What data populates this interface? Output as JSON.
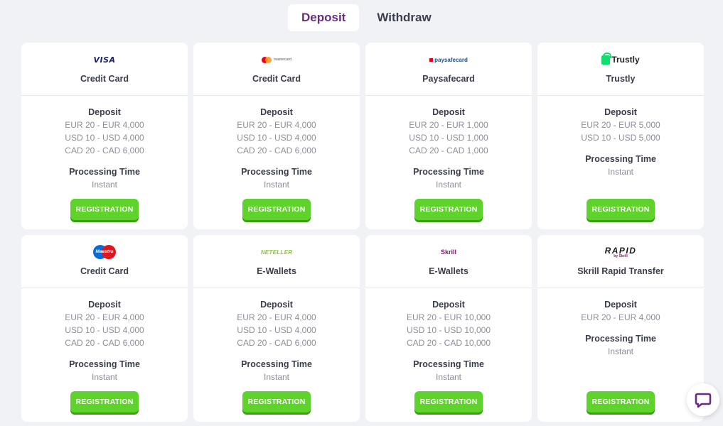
{
  "tabs": [
    {
      "label": "Deposit",
      "active": true
    },
    {
      "label": "Withdraw",
      "active": false
    }
  ],
  "labels": {
    "deposit": "Deposit",
    "processing_time": "Processing Time",
    "button": "REGISTRATION"
  },
  "methods": [
    {
      "logo": "visa-logo",
      "logo_text": "VISA",
      "name": "Credit Card",
      "limits": [
        "EUR 20 - EUR 4,000",
        "USD 10 - USD 4,000",
        "CAD 20 - CAD 6,000"
      ],
      "time": "Instant"
    },
    {
      "logo": "mastercard-logo",
      "logo_text": "mastercard",
      "name": "Credit Card",
      "limits": [
        "EUR 20 - EUR 4,000",
        "USD 10 - USD 4,000",
        "CAD 20 - CAD 6,000"
      ],
      "time": "Instant"
    },
    {
      "logo": "paysafecard-logo",
      "logo_text": "paysafecard",
      "name": "Paysafecard",
      "limits": [
        "EUR 20 - EUR 1,000",
        "USD 10 - USD 1,000",
        "CAD 20 - CAD 1,000"
      ],
      "time": "Instant"
    },
    {
      "logo": "trustly-logo",
      "logo_text": "Trustly",
      "name": "Trustly",
      "limits": [
        "EUR 20 - EUR 5,000",
        "USD 10 - USD 5,000"
      ],
      "time": "Instant"
    },
    {
      "logo": "maestro-logo",
      "logo_text": "Maestro",
      "name": "Credit Card",
      "limits": [
        "EUR 20 - EUR 4,000",
        "USD 10 - USD 4,000",
        "CAD 20 - CAD 6,000"
      ],
      "time": "Instant"
    },
    {
      "logo": "neteller-logo",
      "logo_text": "NETELLER",
      "name": "E-Wallets",
      "limits": [
        "EUR 20 - EUR 4,000",
        "USD 10 - USD 4,000",
        "CAD 20 - CAD 6,000"
      ],
      "time": "Instant"
    },
    {
      "logo": "skrill-logo",
      "logo_text": "Skrill",
      "name": "E-Wallets",
      "limits": [
        "EUR 20 - EUR 10,000",
        "USD 10 - USD 10,000",
        "CAD 20 - CAD 10,000"
      ],
      "time": "Instant"
    },
    {
      "logo": "rapid-transfer-logo",
      "logo_text": "RAPID",
      "logo_subtext": "by Skrill",
      "name": "Skrill Rapid Transfer",
      "limits": [
        "EUR 20 - EUR 4,000"
      ],
      "time": "Instant"
    }
  ],
  "chat": {
    "icon": "chat-bubble-icon",
    "color": "#6a2b86"
  },
  "colors": {
    "accent": "#6a2b86",
    "button": "#5fd32b",
    "background": "#f1f2f6"
  }
}
